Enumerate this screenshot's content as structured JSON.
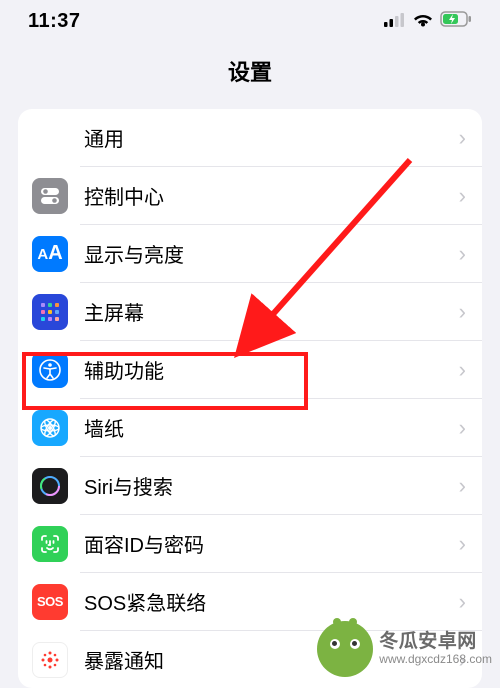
{
  "status": {
    "time": "11:37"
  },
  "header": {
    "title": "设置"
  },
  "rows": [
    {
      "id": "general",
      "label": "通用",
      "iconBg": "#8e8e93"
    },
    {
      "id": "control-center",
      "label": "控制中心",
      "iconBg": "#8e8e93"
    },
    {
      "id": "display",
      "label": "显示与亮度",
      "iconBg": "#007aff"
    },
    {
      "id": "home-screen",
      "label": "主屏幕",
      "iconBg": "#2947d9"
    },
    {
      "id": "accessibility",
      "label": "辅助功能",
      "iconBg": "#007aff"
    },
    {
      "id": "wallpaper",
      "label": "墙纸",
      "iconBg": "#17a8ff"
    },
    {
      "id": "siri",
      "label": "Siri与搜索",
      "iconBg": "#1c1c1e"
    },
    {
      "id": "faceid",
      "label": "面容ID与密码",
      "iconBg": "#30d158"
    },
    {
      "id": "sos",
      "label": "SOS紧急联络",
      "iconBg": "#ff3b30"
    },
    {
      "id": "exposure",
      "label": "暴露通知",
      "iconBg": "#ffffff"
    }
  ],
  "watermark": {
    "line1": "冬瓜安卓网",
    "line2": "www.dgxcdz168.com"
  }
}
